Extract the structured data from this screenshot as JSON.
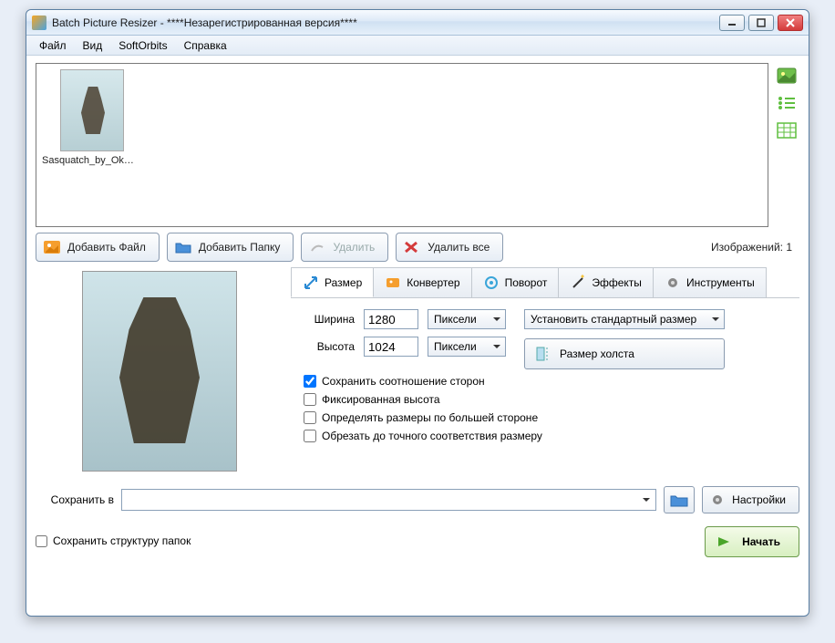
{
  "window": {
    "title": "Batch Picture Resizer - ****Незарегистрированная версия****"
  },
  "menu": {
    "file": "Файл",
    "view": "Вид",
    "softorbits": "SoftOrbits",
    "help": "Справка"
  },
  "thumbnail": {
    "caption": "Sasquatch_by_Okmer..."
  },
  "toolbar": {
    "add_file": "Добавить Файл",
    "add_folder": "Добавить Папку",
    "delete": "Удалить",
    "delete_all": "Удалить все",
    "image_count_label": "Изображений: 1"
  },
  "tabs": {
    "size": "Размер",
    "converter": "Конвертер",
    "rotate": "Поворот",
    "effects": "Эффекты",
    "tools": "Инструменты"
  },
  "size_panel": {
    "width_label": "Ширина",
    "height_label": "Высота",
    "width_value": "1280",
    "height_value": "1024",
    "unit_width": "Пиксели",
    "unit_height": "Пиксели",
    "std_size": "Установить стандартный размер",
    "canvas_size": "Размер холста",
    "keep_ratio": "Сохранить соотношение сторон",
    "fixed_height": "Фиксированная высота",
    "detect_by_longer": "Определять размеры по большей стороне",
    "crop_exact": "Обрезать до точного соответствия размеру"
  },
  "save": {
    "label": "Сохранить в",
    "value": "",
    "settings": "Настройки",
    "keep_folder_structure": "Сохранить структуру папок",
    "start": "Начать"
  }
}
